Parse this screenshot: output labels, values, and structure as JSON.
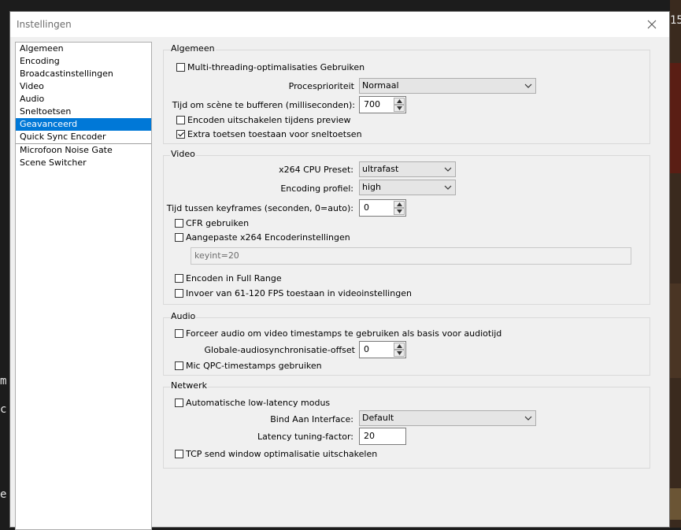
{
  "window": {
    "title": "Instellingen"
  },
  "sidebar": {
    "items": [
      {
        "label": "Algemeen",
        "selected": false
      },
      {
        "label": "Encoding",
        "selected": false
      },
      {
        "label": "Broadcastinstellingen",
        "selected": false
      },
      {
        "label": "Video",
        "selected": false
      },
      {
        "label": "Audio",
        "selected": false
      },
      {
        "label": "Sneltoetsen",
        "selected": false
      },
      {
        "label": "Geavanceerd",
        "selected": true
      },
      {
        "label": "Quick Sync Encoder",
        "selected": false
      },
      {
        "label": "Microfoon Noise Gate",
        "selected": false
      },
      {
        "label": "Scene Switcher",
        "selected": false
      }
    ]
  },
  "background": {
    "text1": "m",
    "text2": "c",
    "text3": "e",
    "text4": "15"
  },
  "general": {
    "title": "Algemeen",
    "multithreading": {
      "label": "Multi-threading-optimalisaties Gebruiken",
      "checked": false
    },
    "priority": {
      "label": "Procesprioriteit",
      "value": "Normaal"
    },
    "buffer": {
      "label": "Tijd om scène te bufferen (milliseconden):",
      "value": "700"
    },
    "disable_preview_encoding": {
      "label": "Encoden uitschakelen tijdens preview",
      "checked": false
    },
    "extra_hotkeys": {
      "label": "Extra toetsen toestaan voor sneltoetsen",
      "checked": true
    }
  },
  "video": {
    "title": "Video",
    "preset": {
      "label": "x264 CPU Preset:",
      "value": "ultrafast"
    },
    "profile": {
      "label": "Encoding profiel:",
      "value": "high"
    },
    "keyframes": {
      "label": "Tijd tussen keyframes (seconden, 0=auto):",
      "value": "0"
    },
    "cfr": {
      "label": "CFR gebruiken",
      "checked": false
    },
    "custom_x264": {
      "label": "Aangepaste x264 Encoderinstellingen",
      "checked": false
    },
    "custom_x264_value": "keyint=20",
    "full_range": {
      "label": "Encoden in Full Range",
      "checked": false
    },
    "fps_input": {
      "label": "Invoer van 61-120 FPS toestaan in videoinstellingen",
      "checked": false
    }
  },
  "audio": {
    "title": "Audio",
    "force_timestamps": {
      "label": "Forceer audio om video timestamps te gebruiken als basis voor audiotijd",
      "checked": false
    },
    "sync_offset": {
      "label": "Globale-audiosynchronisatie-offset",
      "value": "0"
    },
    "mic_qpc": {
      "label": "Mic QPC-timestamps gebruiken",
      "checked": false
    }
  },
  "network": {
    "title": "Netwerk",
    "low_latency": {
      "label": "Automatische low-latency modus",
      "checked": false
    },
    "bind_interface": {
      "label": "Bind Aan Interface:",
      "value": "Default"
    },
    "latency_factor": {
      "label": "Latency tuning-factor:",
      "value": "20"
    },
    "tcp_optim": {
      "label": "TCP send window optimalisatie uitschakelen",
      "checked": false
    }
  }
}
